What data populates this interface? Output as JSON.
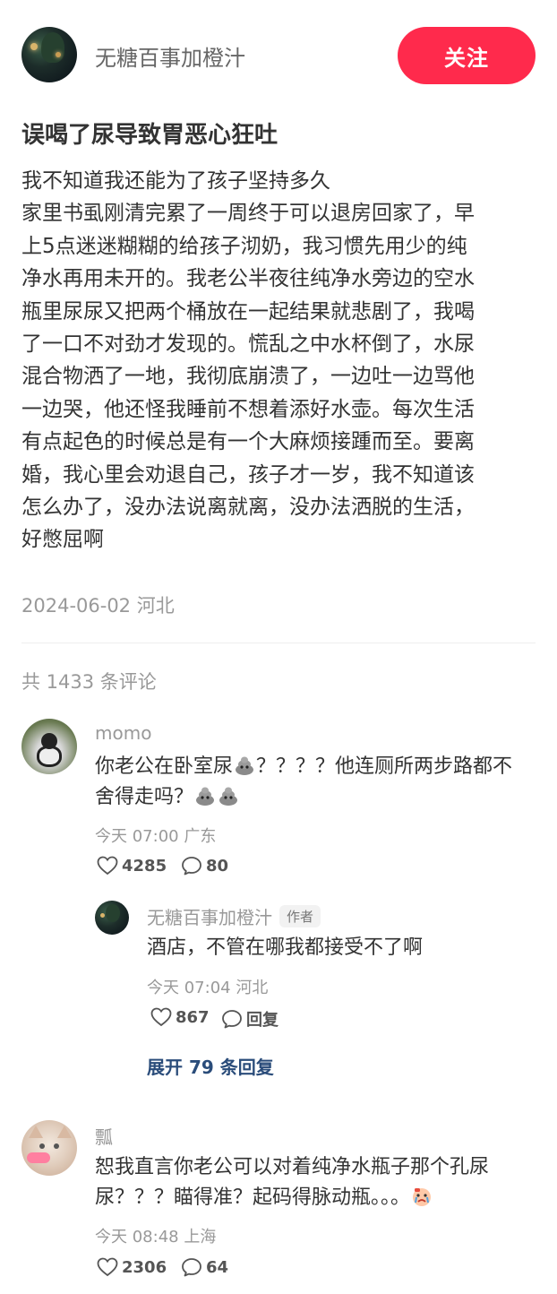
{
  "header": {
    "author_name": "无糖百事加橙汁",
    "follow_label": "关注"
  },
  "post": {
    "title": "误喝了尿导致胃恶心狂吐",
    "body_lines": [
      "我不知道我还能为了孩子坚持多久",
      "家里书虱刚清完累了一周终于可以退房回家了，早",
      "上5点迷迷糊糊的给孩子沏奶，我习惯先用少的纯",
      "净水再用未开的。我老公半夜往纯净水旁边的空水",
      "瓶里尿尿又把两个桶放在一起结果就悲剧了，我喝",
      "了一口不对劲才发现的。慌乱之中水杯倒了，水尿",
      "混合物洒了一地，我彻底崩溃了，一边吐一边骂他",
      "一边哭，他还怪我睡前不想着添好水壶。每次生活",
      "有点起色的时候总是有一个大麻烦接踵而至。要离",
      "婚，我心里会劝退自己，孩子才一岁，我不知道该",
      "怎么办了，没办法说离就离，没办法洒脱的生活，",
      "好憋屈啊"
    ],
    "date": "2024-06-02",
    "location": "河北"
  },
  "comments_header": {
    "text": "共 1433 条评论"
  },
  "comments": [
    {
      "user": "momo",
      "line1_a": "你老公在卧室尿",
      "line1_b": "？？？？他连厕所两步路都不",
      "line2": "舍得走吗？",
      "emoji_name": "poop-emoji",
      "time": "今天 07:00",
      "location": "广东",
      "likes": "4285",
      "replies": "80"
    },
    {
      "user": "瓢",
      "line1": "恕我直言你老公可以对着纯净水瓶子那个孔尿",
      "line2": "尿？？？瞄得准？起码得脉动瓶。。。",
      "emoji_name": "crying-face-emoji",
      "time": "今天 08:48",
      "location": "上海",
      "likes": "2306",
      "replies": "64"
    }
  ],
  "reply": {
    "user": "无糖百事加橙汁",
    "author_tag": "作者",
    "text": "酒店，不管在哪我都接受不了啊",
    "time": "今天 07:04",
    "location": "河北",
    "likes": "867",
    "reply_label": "回复"
  },
  "expand_label": "展开 79 条回复",
  "colors": {
    "follow_button": "#ff2a4c",
    "expand_link": "#2a4c7a",
    "meta_gray": "#999999"
  }
}
